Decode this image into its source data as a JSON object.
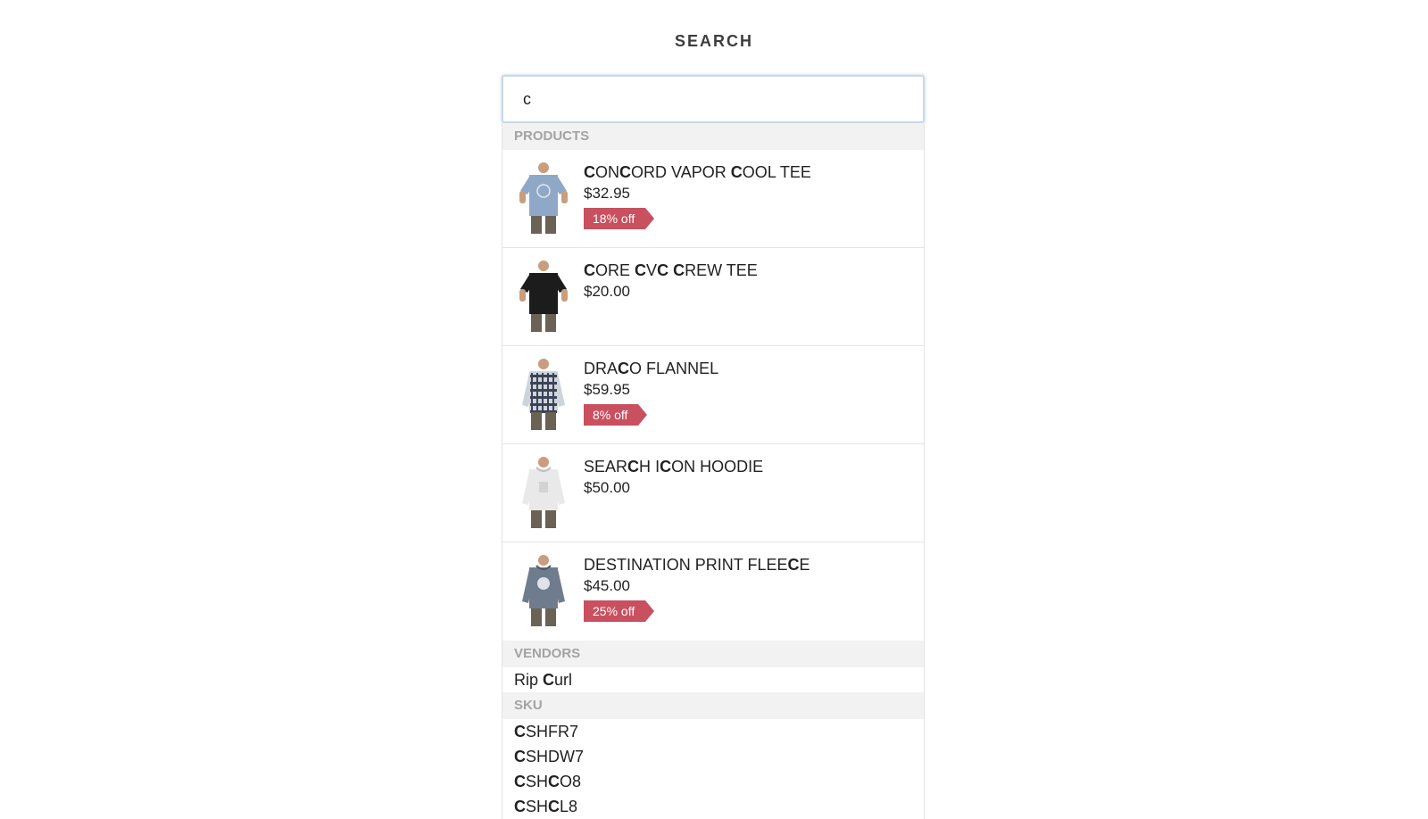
{
  "header": {
    "title": "SEARCH"
  },
  "search": {
    "value": "c",
    "highlight": "C"
  },
  "sections": {
    "products_label": "PRODUCTS",
    "vendors_label": "VENDORS",
    "sku_label": "SKU"
  },
  "products": [
    {
      "name": "CONCORD VAPOR COOL TEE",
      "price": "$32.95",
      "discount": "18% off",
      "image": "light-blue-tee-icon"
    },
    {
      "name": "CORE CVC CREW TEE",
      "price": "$20.00",
      "discount": "",
      "image": "black-tee-icon"
    },
    {
      "name": "DRACO FLANNEL",
      "price": "$59.95",
      "discount": "8% off",
      "image": "plaid-flannel-icon"
    },
    {
      "name": "SEARCH ICON HOODIE",
      "price": "$50.00",
      "discount": "",
      "image": "white-hoodie-icon"
    },
    {
      "name": "DESTINATION PRINT FLEECE",
      "price": "$45.00",
      "discount": "25% off",
      "image": "grey-fleece-icon"
    }
  ],
  "vendors": [
    "Rip Curl"
  ],
  "skus": [
    "CSHFR7",
    "CSHDW7",
    "CSHCO8",
    "CSHCL8"
  ],
  "colors": {
    "badge": "#c8505f",
    "section_bg": "#f2f2f2",
    "section_text": "#a3a3a3",
    "input_border": "#c9d9e8"
  }
}
